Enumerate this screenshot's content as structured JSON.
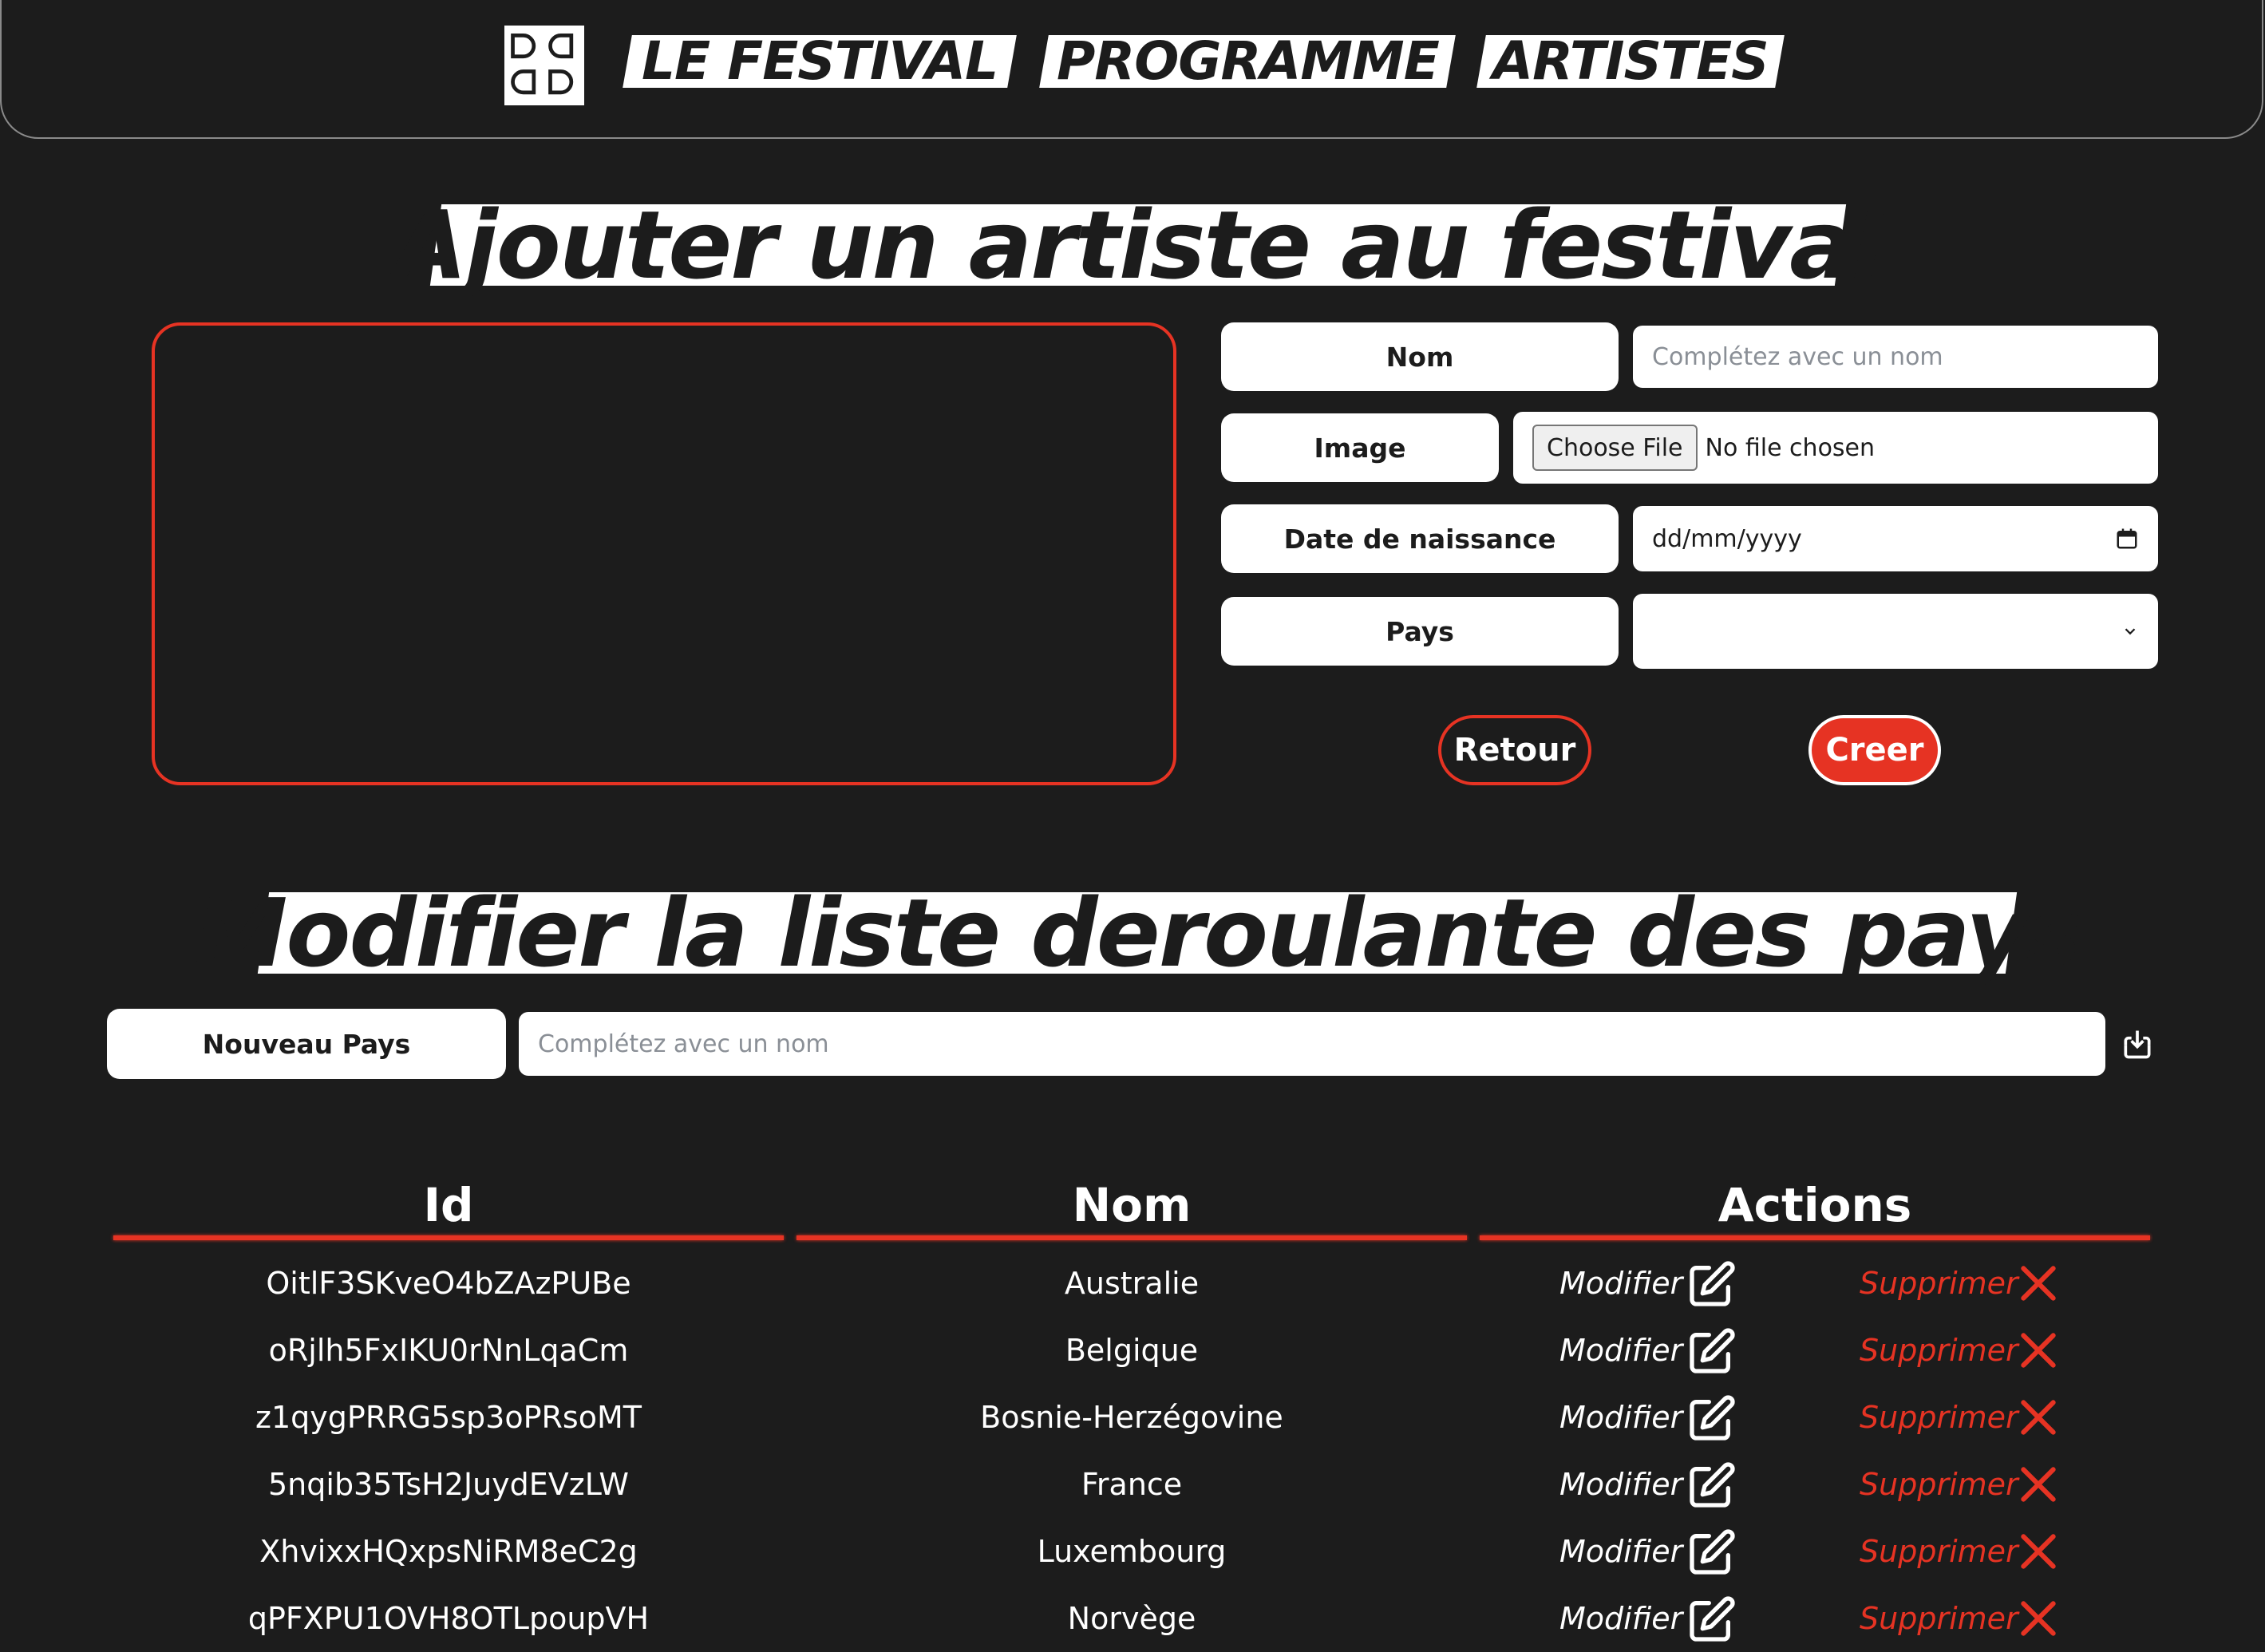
{
  "nav": {
    "items": [
      {
        "label": "LE FESTIVAL"
      },
      {
        "label": "PROGRAMME"
      },
      {
        "label": "ARTISTES"
      }
    ]
  },
  "add_artist": {
    "title": "Ajouter un artiste au festival",
    "name_label": "Nom",
    "name_placeholder": "Complétez avec un nom",
    "image_label": "Image",
    "choose_file": "Choose File",
    "no_file": "No file chosen",
    "birth_label": "Date de naissance",
    "birth_value": "dd/mm/yyyy",
    "country_label": "Pays",
    "country_value": "",
    "back_button": "Retour",
    "create_button": "Creer"
  },
  "countries": {
    "title": "Modifier la liste deroulante des pays",
    "new_label": "Nouveau Pays",
    "new_placeholder": "Complétez avec un nom",
    "columns": [
      "Id",
      "Nom",
      "Actions"
    ],
    "edit_label": "Modifier",
    "delete_label": "Supprimer",
    "rows": [
      {
        "id": "OitlF3SKveO4bZAzPUBe",
        "name": "Australie"
      },
      {
        "id": "oRjlh5FxIKU0rNnLqaCm",
        "name": "Belgique"
      },
      {
        "id": "z1qygPRRG5sp3oPRsoMT",
        "name": "Bosnie-Herzégovine"
      },
      {
        "id": "5nqib35TsH2JuydEVzLW",
        "name": "France"
      },
      {
        "id": "XhvixxHQxpsNiRM8eC2g",
        "name": "Luxembourg"
      },
      {
        "id": "qPFXPU1OVH8OTLpoupVH",
        "name": "Norvège"
      }
    ]
  },
  "colors": {
    "background": "#1c1c1c",
    "accent": "#e63323",
    "text": "#ffffff"
  }
}
